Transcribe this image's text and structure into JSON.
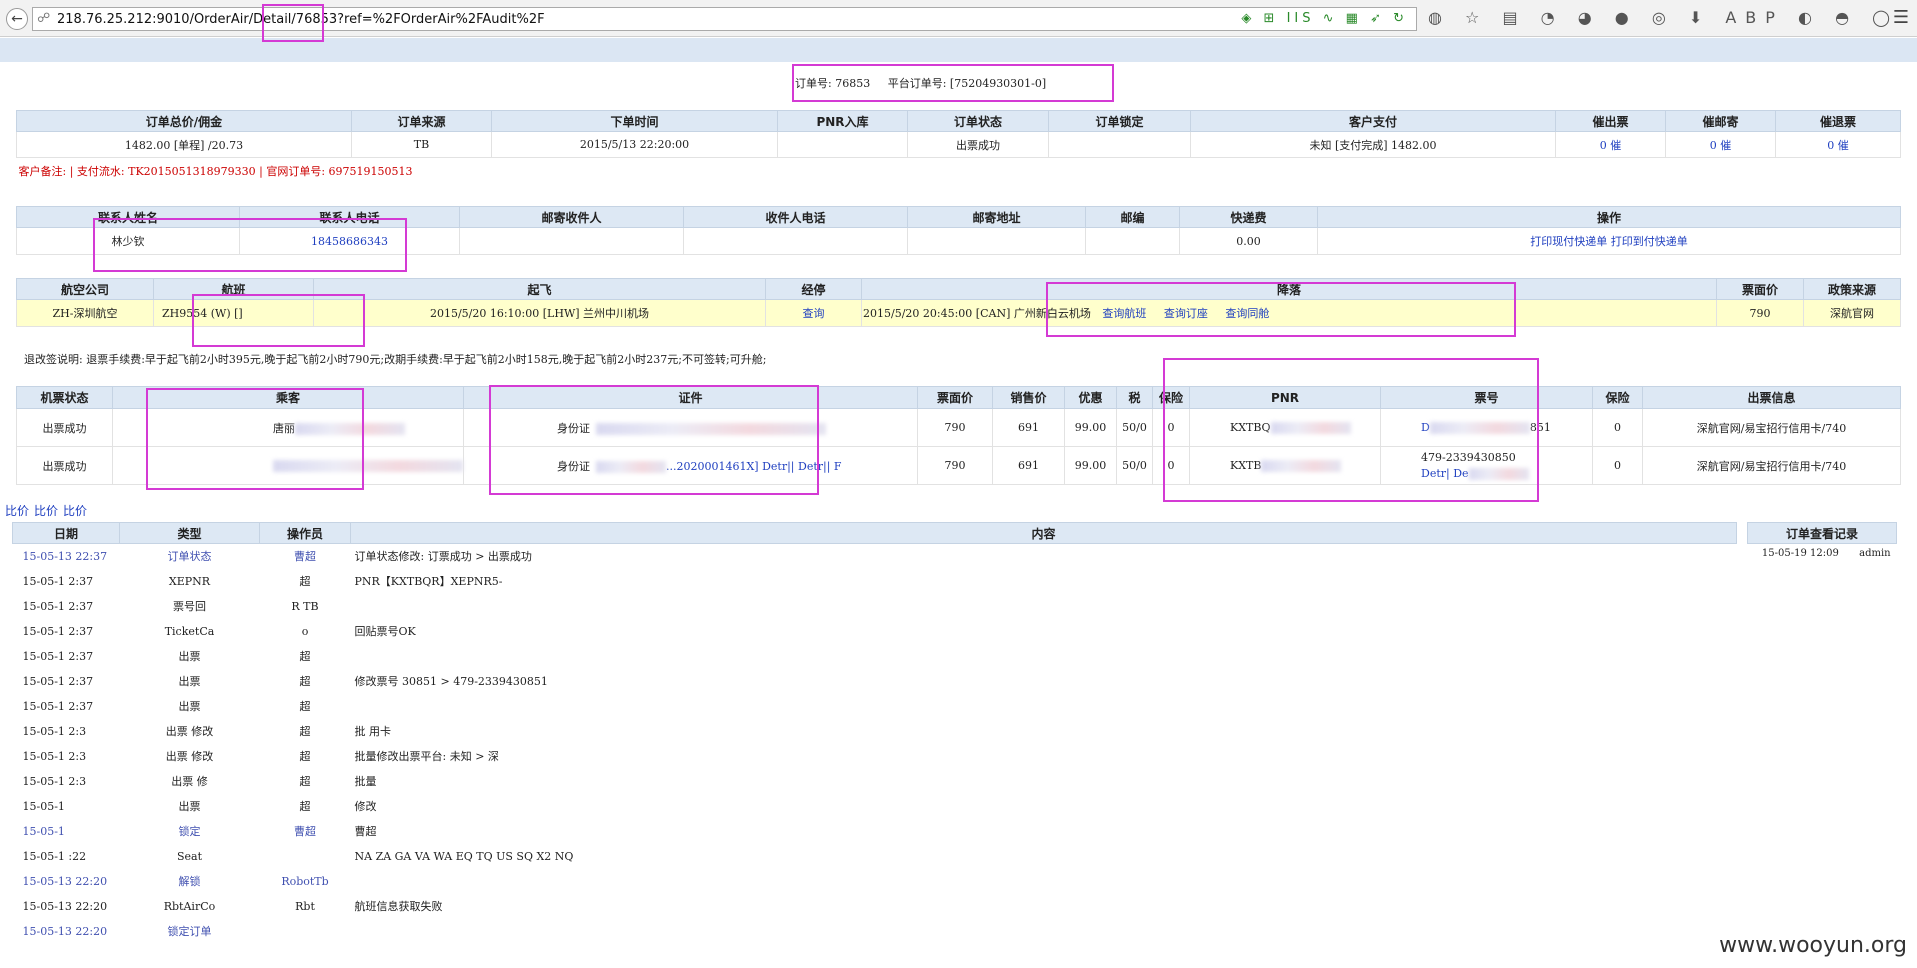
{
  "browser": {
    "back_icon": "back-arrow-icon",
    "url": "218.76.25.212:9010/OrderAir/Detail/76853?ref=%2FOrderAir%2FAudit%2F",
    "url_icons": "◈ ⊞ IIS ∿ ▦ ➶ ↻",
    "toolbar_icons": "◍ ☆ ▤ ◔ ◕ ● ◎ ⬇ ABP ◐ ◓ ◯",
    "menu_icon": "☰"
  },
  "header": {
    "order_no": "订单号: 76853",
    "platform_no": "平台订单号: [75204930301-0]"
  },
  "order": {
    "headers": [
      "订单总价/佣金",
      "订单来源",
      "下单时间",
      "PNR入库",
      "订单状态",
      "订单锁定",
      "客户支付",
      "催出票",
      "催邮寄",
      "催退票"
    ],
    "row": [
      "1482.00 [单程] /20.73",
      "TB",
      "2015/5/13 22:20:00",
      "",
      "出票成功",
      "",
      "未知 [支付完成] 1482.00",
      "0 催",
      "0 催",
      "0 催"
    ],
    "remark": "客户备注:  | 支付流水: TK2015051318979330 | 官网订单号: 697519150513"
  },
  "contact": {
    "headers": [
      "联系人姓名",
      "联系人电话",
      "邮寄收件人",
      "收件人电话",
      "邮寄地址",
      "邮编",
      "快递费",
      "操作"
    ],
    "row": [
      "林少钦",
      "18458686343",
      "",
      "",
      "",
      "",
      "0.00"
    ],
    "action1": "打印现付快递单",
    "action2": "打印到付快递单"
  },
  "flight": {
    "headers": [
      "航空公司",
      "航班",
      "起飞",
      "经停",
      "降落",
      "票面价",
      "政策来源"
    ],
    "airline": "ZH-深圳航空",
    "flight_no": "ZH9554 (W) []",
    "depart": "2015/5/20 16:10:00 [LHW] 兰州中川机场",
    "stop": "查询",
    "arrive": "2015/5/20 20:45:00 [CAN] 广州新白云机场",
    "arrive_links": [
      "查询航班",
      "查询订座",
      "查询同舱"
    ],
    "price": "790",
    "policy": "深航官网"
  },
  "refund_note": "退改签说明: 退票手续费:早于起飞前2小时395元,晚于起飞前2小时790元;改期手续费:早于起飞前2小时158元,晚于起飞前2小时237元;不可签转;可升舱;",
  "tickets": {
    "headers": [
      "机票状态",
      "乘客",
      "证件",
      "票面价",
      "销售价",
      "优惠",
      "税",
      "保险",
      "PNR",
      "票号",
      "保险",
      "出票信息"
    ],
    "rows": [
      {
        "status": "出票成功",
        "passenger": "唐丽",
        "id_type": "身份证",
        "id_text": "",
        "face": "790",
        "sale": "691",
        "discount": "99.00",
        "tax": "50/0",
        "ins": "0",
        "pnr": "KXTBQ",
        "ticket_no": "851",
        "ticket_links": "D",
        "ins2": "0",
        "issue": "深航官网/易宝招行信用卡/740"
      },
      {
        "status": "出票成功",
        "passenger": "",
        "id_type": "身份证",
        "id_text": "...2020001461X] Detr|| Detr|| F",
        "face": "790",
        "sale": "691",
        "discount": "99.00",
        "tax": "50/0",
        "ins": "0",
        "pnr": "KXTB",
        "ticket_no": "479-2339430850",
        "ticket_links": "Detr| De",
        "ins2": "0",
        "issue": "深航官网/易宝招行信用卡/740"
      }
    ]
  },
  "compare_links": [
    "比价",
    "比价",
    "比价"
  ],
  "log": {
    "headers": [
      "日期",
      "类型",
      "操作员",
      "内容"
    ],
    "rows": [
      {
        "date": "15-05-13 22:37",
        "type": "订单状态",
        "op": "曹超",
        "content": "订单状态修改: 订票成功 > 出票成功",
        "blue": true
      },
      {
        "date": "15-05-1  2:37",
        "type": "XEPNR",
        "op": "超",
        "content": "PNR【KXTBQR】XEPNR5-",
        "blue": false
      },
      {
        "date": "15-05-1  2:37",
        "type": "票号回",
        "op": "R    TB",
        "content": "",
        "blue": false
      },
      {
        "date": "15-05-1  2:37",
        "type": "TicketCa",
        "op": "o",
        "content": "回贴票号OK",
        "blue": false
      },
      {
        "date": "15-05-1  2:37",
        "type": "出票",
        "op": "超",
        "content": "",
        "blue": false
      },
      {
        "date": "15-05-1  2:37",
        "type": "出票",
        "op": "超",
        "content": "修改票号        30851 > 479-2339430851",
        "blue": false
      },
      {
        "date": "15-05-1  2:37",
        "type": "出票",
        "op": "超",
        "content": "",
        "blue": false
      },
      {
        "date": "15-05-1  2:3",
        "type": "出票   修改",
        "op": "超",
        "content": "批                    用卡",
        "blue": false
      },
      {
        "date": "15-05-1  2:3",
        "type": "出票   修改",
        "op": "超",
        "content": "批量修改出票平台: 未知 > 深",
        "blue": false
      },
      {
        "date": "15-05-1  2:3",
        "type": "出票   修",
        "op": "超",
        "content": "批量",
        "blue": false
      },
      {
        "date": "15-05-1",
        "type": "出票",
        "op": "超",
        "content": "修改",
        "blue": false
      },
      {
        "date": "15-05-1",
        "type": "锁定",
        "op": "曹超",
        "content": "曹超",
        "blue": true
      },
      {
        "date": "15-05-1  :22",
        "type": "Seat",
        "op": "",
        "content": "NA ZA GA VA WA EQ TQ US SQ X2 NQ",
        "blue": false
      },
      {
        "date": "15-05-13 22:20",
        "type": "解锁",
        "op": "RobotTb",
        "content": "",
        "blue": true
      },
      {
        "date": "15-05-13 22:20",
        "type": "RbtAirCo",
        "op": "Rbt",
        "content": "航班信息获取失败",
        "blue": false
      },
      {
        "date": "15-05-13 22:20",
        "type": "锁定订单",
        "op": "",
        "content": "",
        "blue": true
      }
    ]
  },
  "view_log": {
    "header": "订单查看记录",
    "date": "15-05-19 12:09",
    "user": "admin"
  },
  "watermark": "www.wooyun.org",
  "highlight_color": "#d43ad4"
}
